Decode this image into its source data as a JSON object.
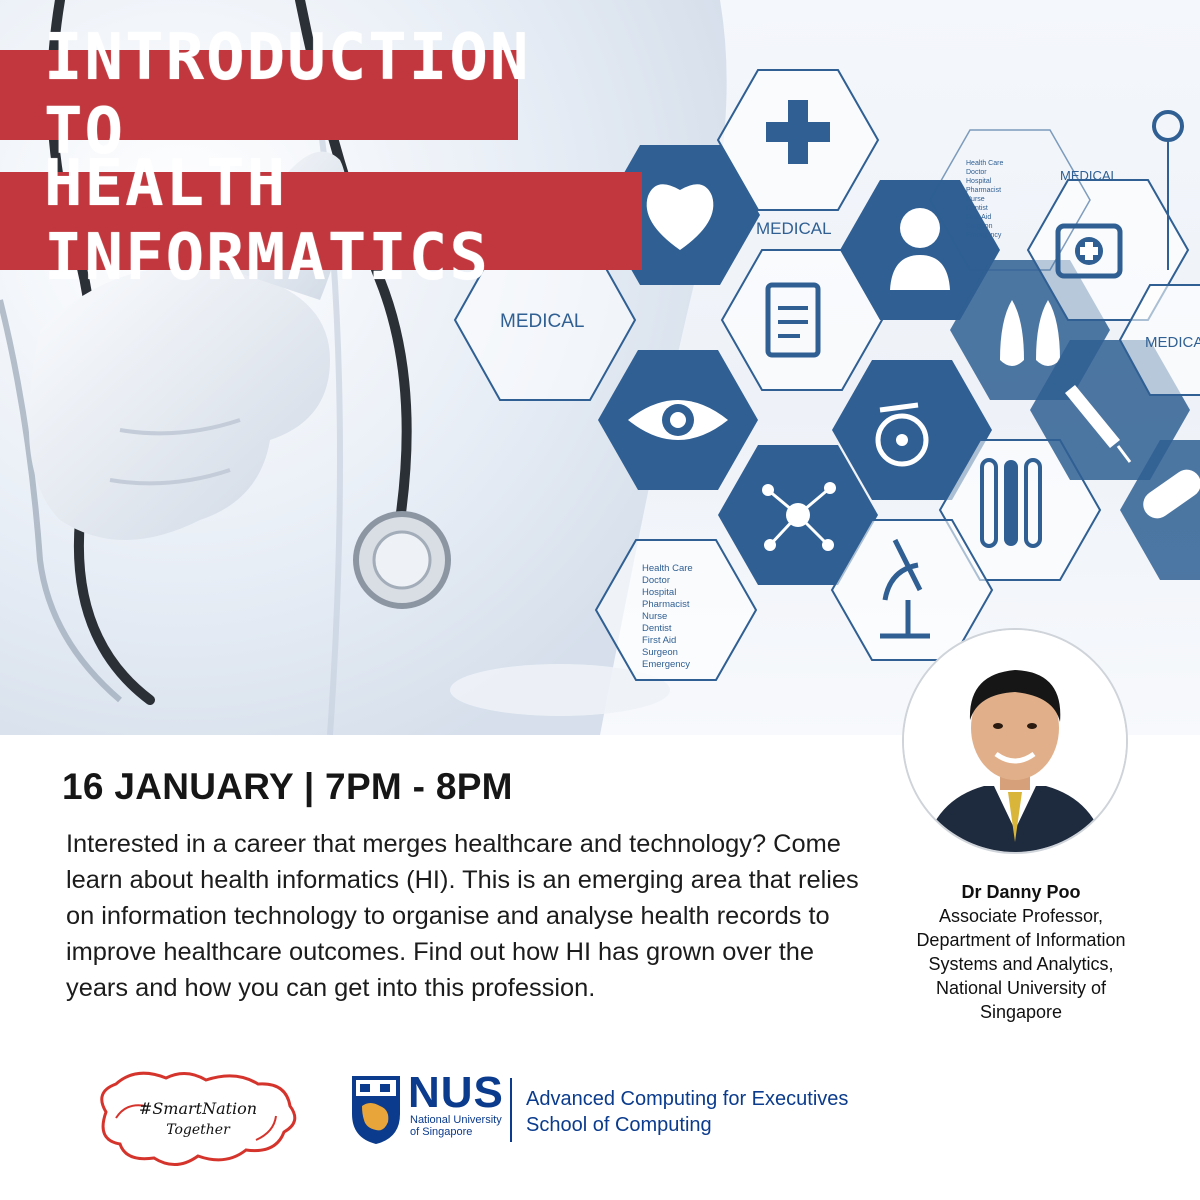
{
  "hero": {
    "title_line1": "INTRODUCTION TO",
    "title_line2": "HEALTH INFORMATICS",
    "hex_labels": {
      "medical": "MEDICAL",
      "list": [
        "Health Care",
        "Doctor",
        "Hospital",
        "Pharmacist",
        "Nurse",
        "Dentist",
        "First Aid",
        "Surgeon",
        "Emergency"
      ]
    }
  },
  "event": {
    "date_time": "16 JANUARY | 7PM - 8PM",
    "description": "Interested in a career that merges healthcare and technology? Come learn about health informatics (HI). This is an emerging area that relies on information technology to organise and analyse health records to improve healthcare outcomes. Find out how HI has grown over the years and how you can get into this profession."
  },
  "speaker": {
    "name": "Dr Danny Poo",
    "title_line1": "Associate Professor,",
    "title_line2": "Department of Information",
    "title_line3": "Systems and Analytics,",
    "title_line4": "National University of",
    "title_line5": "Singapore"
  },
  "logos": {
    "smart_nation_line1": "#SmartNation",
    "smart_nation_line2": "Together",
    "nus_word": "NUS",
    "nus_sub_line1": "National University",
    "nus_sub_line2": "of Singapore",
    "nus_unit_line1": "Advanced Computing for Executives",
    "nus_unit_line2": "School of Computing"
  },
  "colors": {
    "banner_red": "#c1373d",
    "hex_blue": "#2f5f93",
    "nus_blue": "#0b3b8c",
    "smart_red": "#d4342c"
  },
  "icons": [
    "cross-icon",
    "heart-icon",
    "person-icon",
    "clipboard-icon",
    "drops-icon",
    "eye-icon",
    "wheelchair-icon",
    "syringe-icon",
    "molecule-icon",
    "test-tubes-icon",
    "microscope-icon",
    "pill-icon",
    "first-aid-kit-icon"
  ]
}
